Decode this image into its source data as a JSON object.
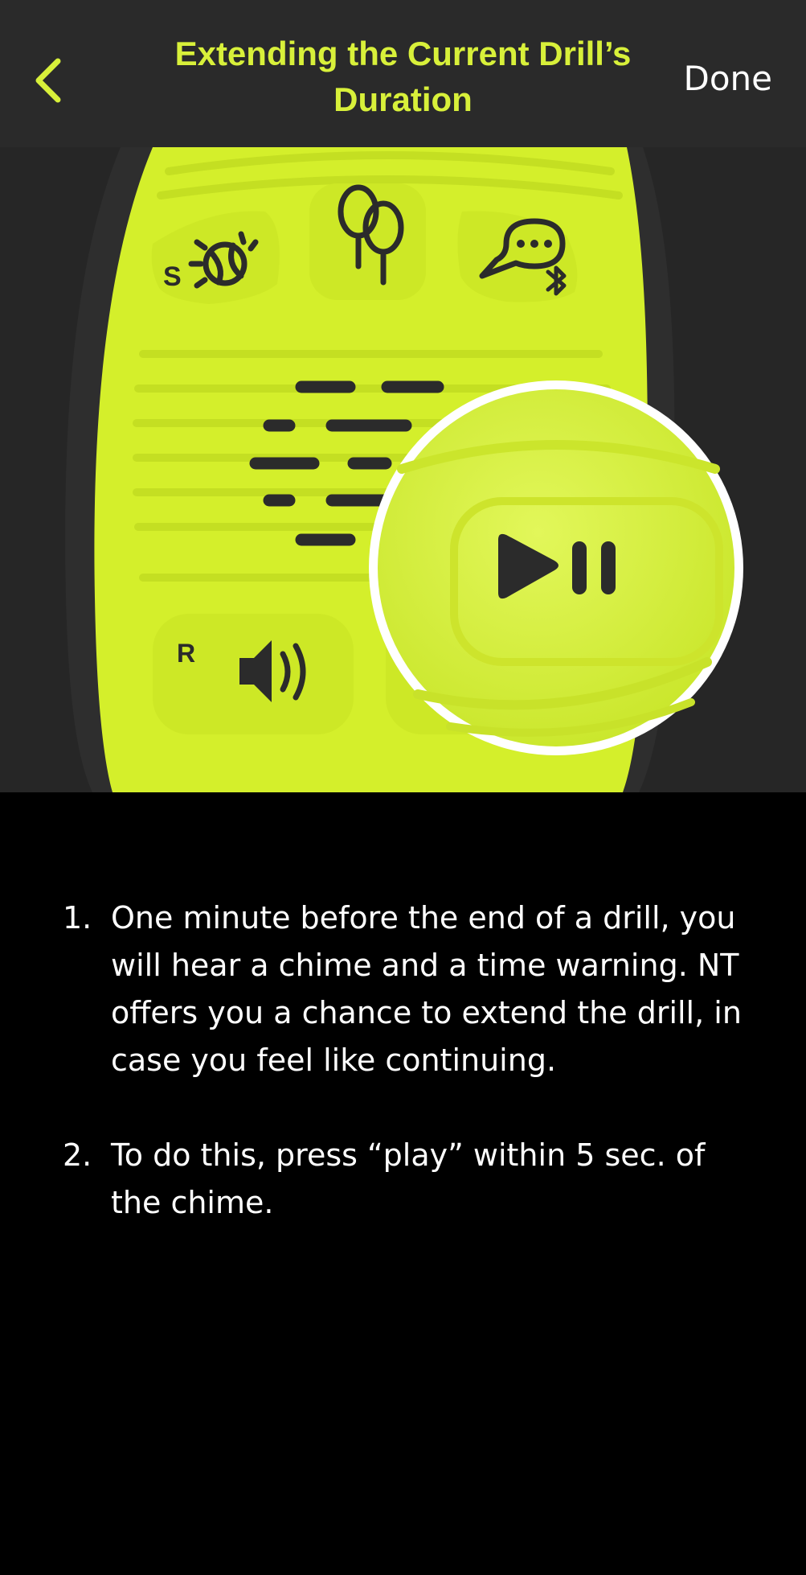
{
  "header": {
    "title": "Extending the Current Drill’s Duration",
    "done_label": "Done",
    "back_icon": "chevron-left-icon"
  },
  "illustration": {
    "device_labels": {
      "s": "S",
      "r": "R"
    },
    "icons": [
      "tennis-ball-icon",
      "rackets-icon",
      "chat-bubble-icon",
      "bluetooth-icon",
      "speaker-icon",
      "play-pause-icon"
    ]
  },
  "steps": [
    {
      "number": "1.",
      "text": "One minute before the end of a drill, you will hear a chime and a time warning. NT offers you a chance to extend the drill, in case you feel like continuing."
    },
    {
      "number": "2.",
      "text": "To do this, press “play” within 5 sec. of the chime."
    }
  ],
  "colors": {
    "accent": "#d8f03a",
    "header_bg": "#2a2a2a",
    "page_bg": "#000000",
    "device_body": "#d4ef2b",
    "device_dark": "#2b2b2b"
  }
}
